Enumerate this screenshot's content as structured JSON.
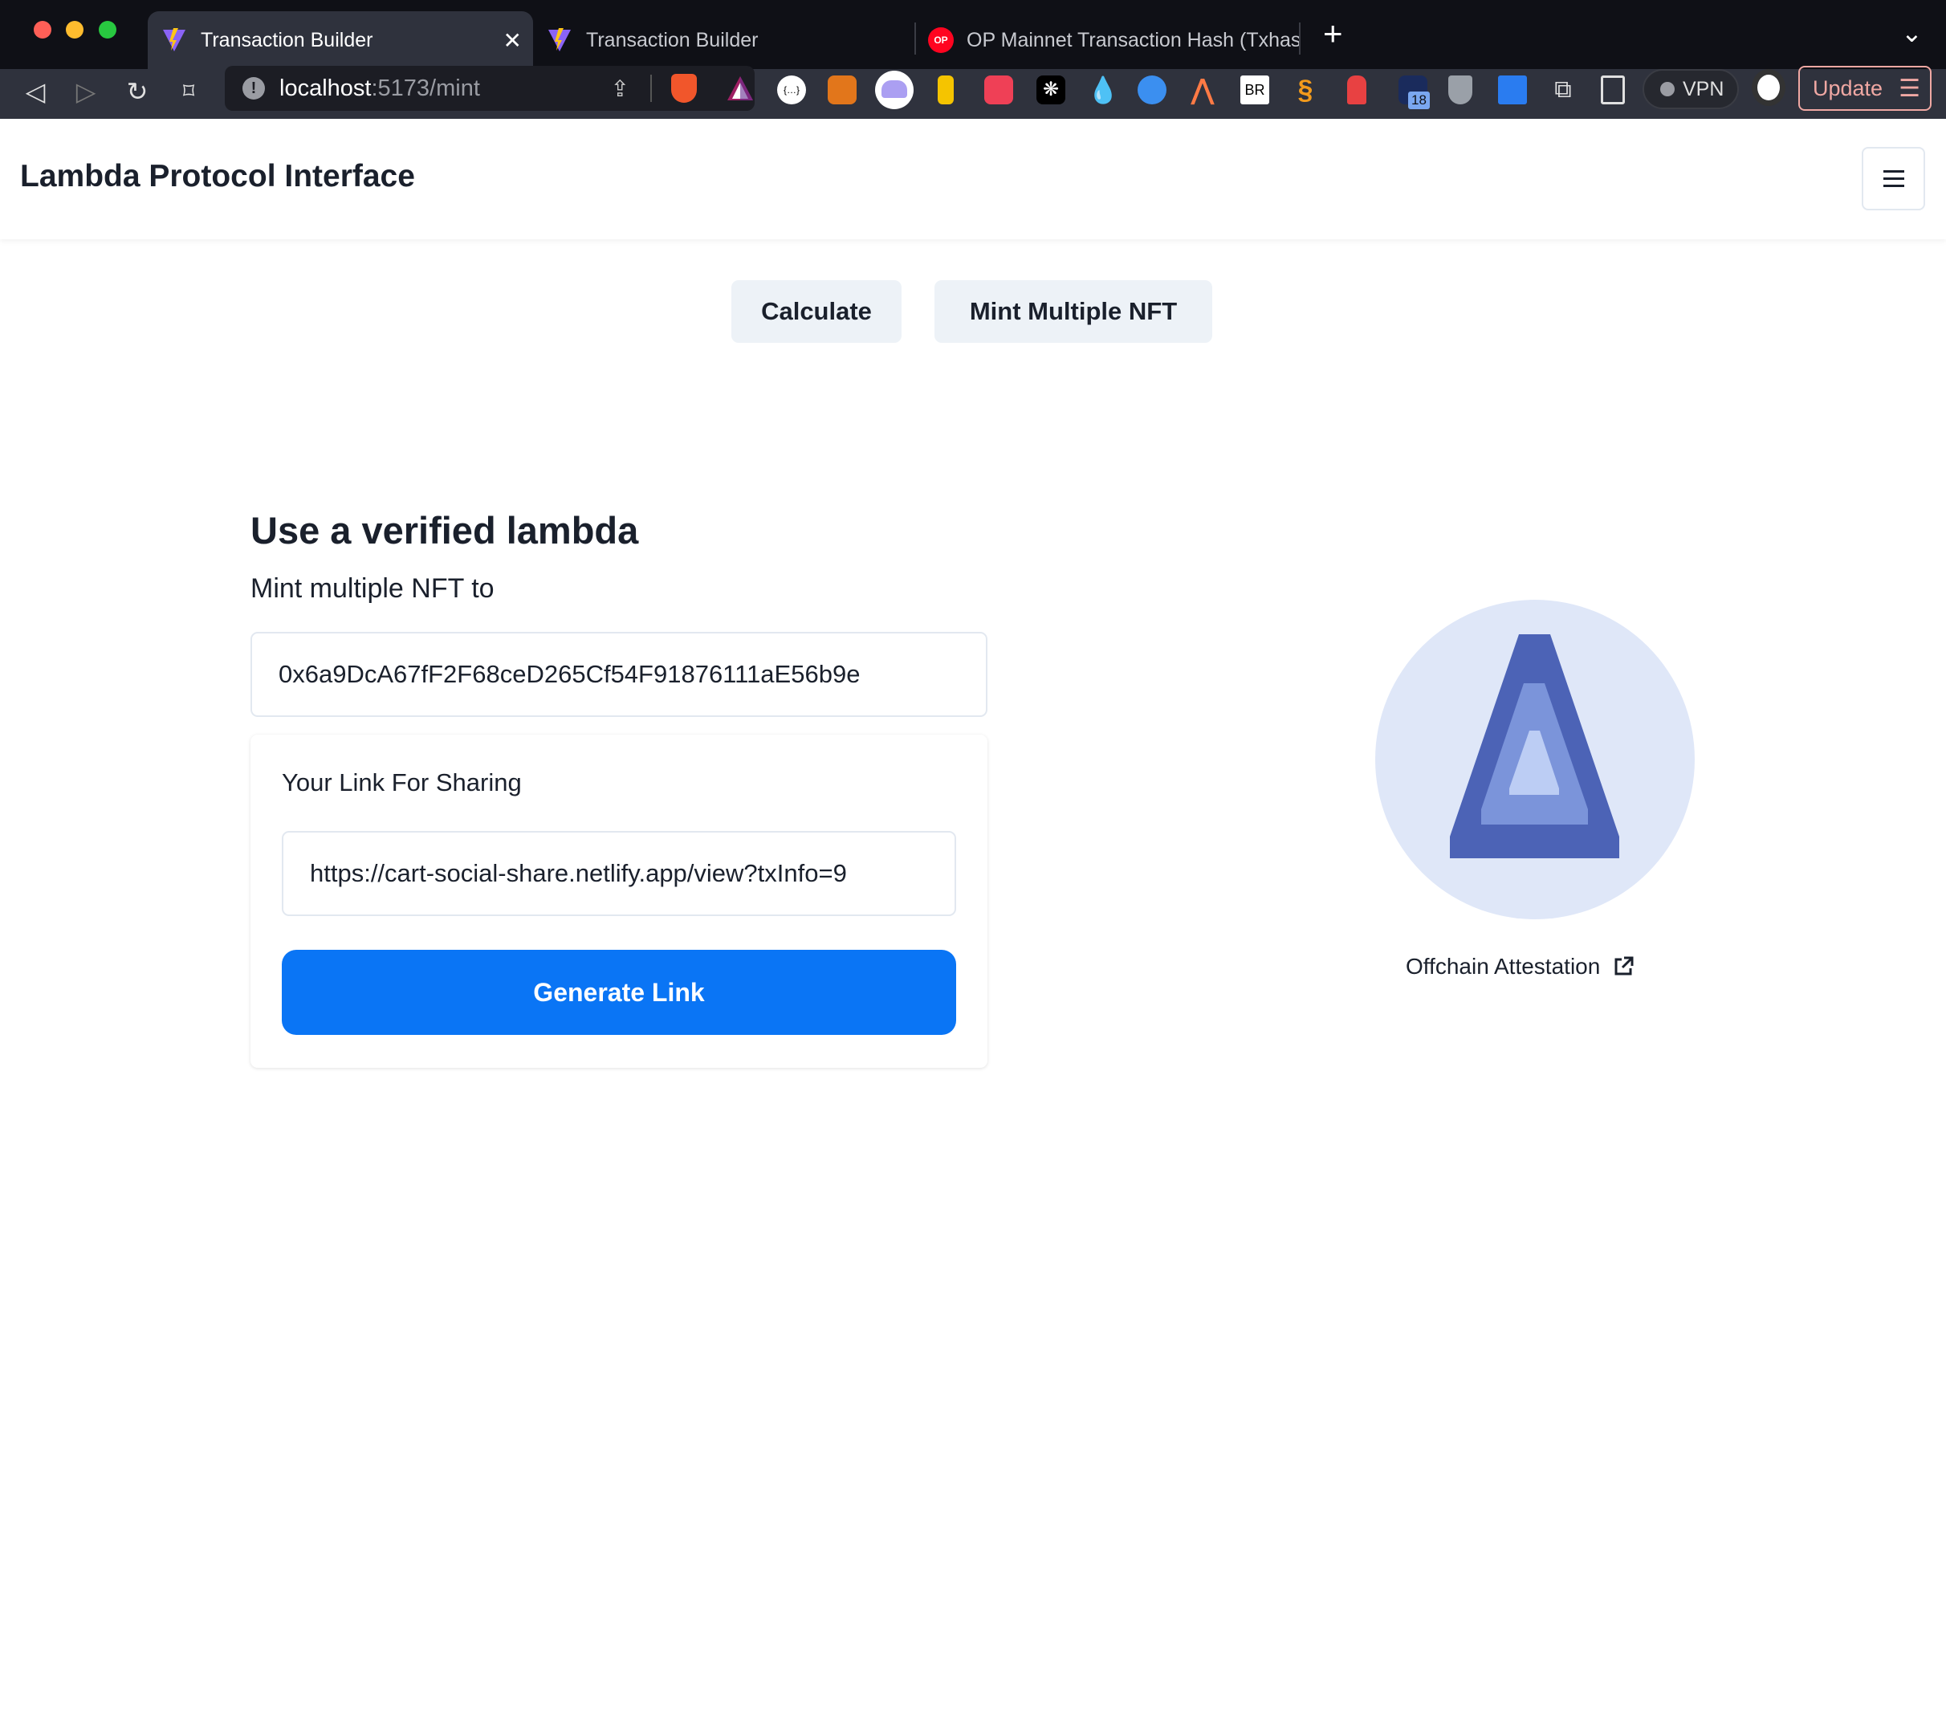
{
  "browser": {
    "tabs": [
      {
        "title": "Transaction Builder",
        "active": true,
        "icon": "vite-icon"
      },
      {
        "title": "Transaction Builder",
        "active": false,
        "icon": "vite-icon"
      },
      {
        "title": "OP Mainnet Transaction Hash (Txhas",
        "active": false,
        "icon": "optimism-icon",
        "icon_text": "OP"
      }
    ],
    "new_tab": "+",
    "tab_menu": "⌄",
    "url_host": "localhost",
    "url_path": ":5173/mint",
    "vpn_label": "VPN",
    "update_label": "Update",
    "extension_badge": "18",
    "extensions": [
      "brave-shield-icon",
      "brave-rewards-icon",
      "json-icon",
      "metamask-icon",
      "phantom-icon",
      "keyholder-icon",
      "pocket-icon",
      "snowflake-icon",
      "drop-icon",
      "wave-icon",
      "spark-icon",
      "br-icon",
      "swirl-icon",
      "lock-icon",
      "extension-badge-icon",
      "shield-icon",
      "send-icon",
      "puzzle-icon",
      "sidebar-icon"
    ]
  },
  "header": {
    "title": "Lambda Protocol Interface",
    "menu_icon": "hamburger-icon"
  },
  "actions": {
    "calculate": "Calculate",
    "mint_multiple": "Mint Multiple NFT"
  },
  "main": {
    "heading": "Use a verified lambda",
    "subheading": "Mint multiple NFT to",
    "address_value": "0x6a9DcA67fF2F68ceD265Cf54F91876111aE56b9e",
    "share_card": {
      "label": "Your Link For Sharing",
      "link_value": "https://cart-social-share.netlify.app/view?txInfo=9",
      "generate_button": "Generate Link"
    }
  },
  "attestation": {
    "label": "Offchain Attestation",
    "colors": {
      "circle": "#dfe7f8",
      "outer": "#4c63b6",
      "middle": "#7b94da",
      "inner": "#bccdf4"
    }
  },
  "colors": {
    "primary": "#0a75f5",
    "button_gray": "#edf2f7"
  }
}
